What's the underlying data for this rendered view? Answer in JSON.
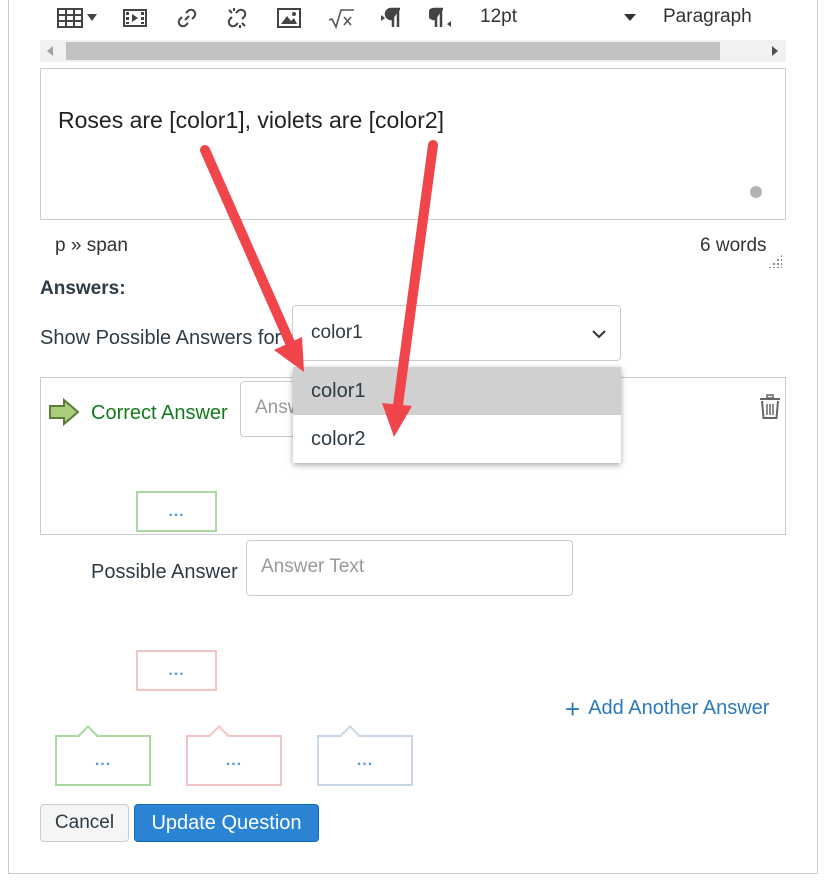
{
  "toolbar": {
    "font_size": "12pt",
    "block_format": "Paragraph",
    "icons": [
      "table-icon",
      "media-icon",
      "link-icon",
      "unlink-icon",
      "image-icon",
      "equation-icon",
      "ltr-paragraph-icon",
      "rtl-paragraph-icon"
    ]
  },
  "editor": {
    "content": "Roses are [color1], violets are [color2]"
  },
  "status": {
    "path": "p » span",
    "word_count": "6 words"
  },
  "answers": {
    "heading": "Answers:",
    "show_label": "Show Possible Answers for",
    "selected": "color1",
    "options": [
      "color1",
      "color2"
    ]
  },
  "correct": {
    "label": "Correct Answer",
    "placeholder": "Answer Text",
    "visible_placeholder": "Answ"
  },
  "possible": {
    "label": "Possible Answer",
    "placeholder": "Answer Text"
  },
  "comment_ellipsis": "...",
  "add_answer_label": "Add Another Answer",
  "buttons": {
    "cancel": "Cancel",
    "update": "Update Question"
  },
  "colors": {
    "correct_green": "#127a1b",
    "link_blue": "#2b7abc",
    "primary_button": "#2b84d3",
    "annotation_arrow": "#f0454a"
  }
}
